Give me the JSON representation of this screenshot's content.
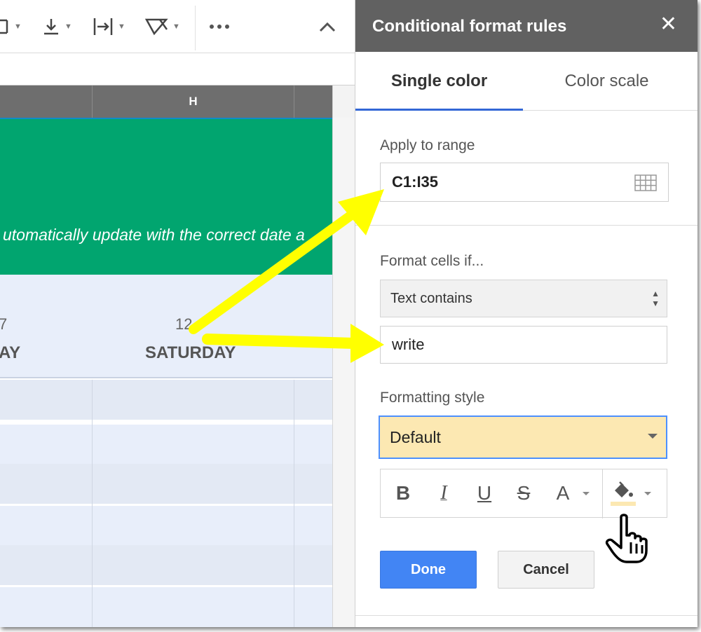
{
  "toolbar": {
    "buttons": [
      {
        "icon": "font-color-icon"
      },
      {
        "icon": "vertical-align-icon"
      },
      {
        "icon": "text-wrap-icon"
      },
      {
        "icon": "text-rotate-icon"
      },
      {
        "icon": "more-icon"
      },
      {
        "icon": "collapse-chevron-up-icon"
      }
    ]
  },
  "sheet": {
    "column_header": "H",
    "banner_text": "utomatically update with the correct date a",
    "banner_color": "#01a56f",
    "days": [
      {
        "num": "7",
        "name": "AY"
      },
      {
        "num": "12",
        "name": "SATURDAY"
      }
    ]
  },
  "panel": {
    "title": "Conditional format rules",
    "close_label": "✕",
    "tabs": [
      {
        "label": "Single color",
        "active": true
      },
      {
        "label": "Color scale",
        "active": false
      }
    ],
    "apply_to_range": {
      "label": "Apply to range",
      "value": "C1:I35"
    },
    "format_cells_if": {
      "label": "Format cells if...",
      "condition": "Text contains",
      "value": "write"
    },
    "formatting_style": {
      "label": "Formatting style",
      "selected": "Default",
      "preview_color": "#fce8b2",
      "bold": "B",
      "italic": "I",
      "underline": "U",
      "strikethrough": "S",
      "text_color": "A"
    },
    "done_label": "Done",
    "cancel_label": "Cancel",
    "accent_color": "#4285f4"
  },
  "annotations": {
    "arrow_color": "#ffff00"
  }
}
